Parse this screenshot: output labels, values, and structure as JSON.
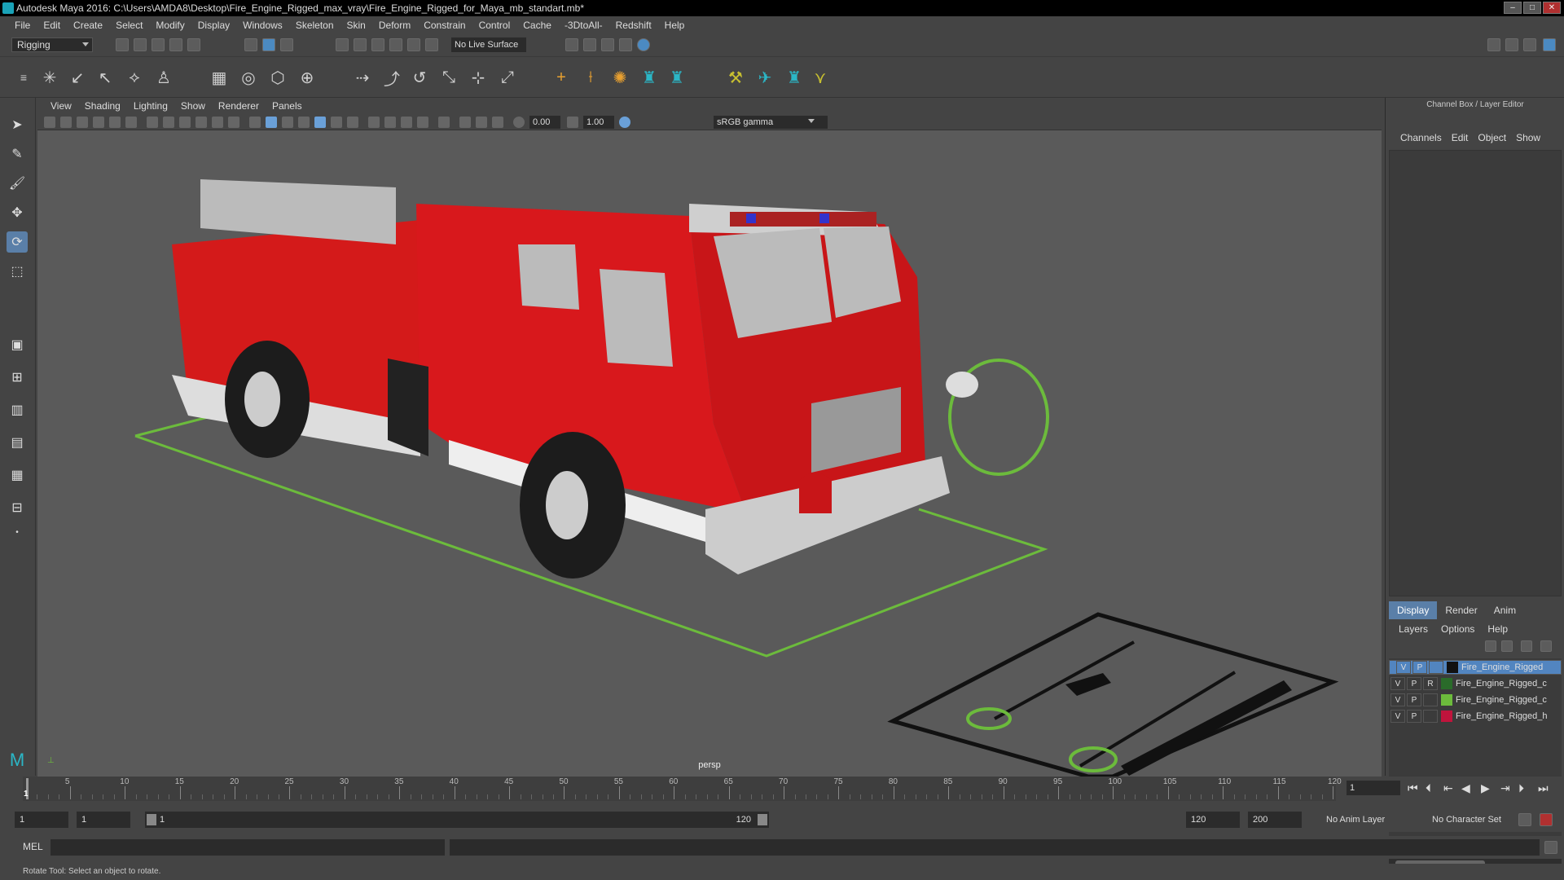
{
  "window": {
    "title": "Autodesk Maya 2016: C:\\Users\\AMDA8\\Desktop\\Fire_Engine_Rigged_max_vray\\Fire_Engine_Rigged_for_Maya_mb_standart.mb*"
  },
  "menubar": [
    "File",
    "Edit",
    "Create",
    "Select",
    "Modify",
    "Display",
    "Windows",
    "Skeleton",
    "Skin",
    "Deform",
    "Constrain",
    "Control",
    "Cache",
    "-3DtoAll-",
    "Redshift",
    "Help"
  ],
  "status_line": {
    "menuset": "Rigging",
    "live_surface": "No Live Surface"
  },
  "viewport": {
    "menu": [
      "View",
      "Shading",
      "Lighting",
      "Show",
      "Renderer",
      "Panels"
    ],
    "exposure": "0.00",
    "gamma": "1.00",
    "color_space": "sRGB gamma",
    "camera_label": "persp"
  },
  "channel_box": {
    "title": "Channel Box / Layer Editor",
    "menu": [
      "Channels",
      "Edit",
      "Object",
      "Show"
    ]
  },
  "layer_editor": {
    "tabs": [
      "Display",
      "Render",
      "Anim"
    ],
    "menu": [
      "Layers",
      "Options",
      "Help"
    ],
    "layers": [
      {
        "v": "V",
        "p": "P",
        "r": "",
        "color": "#111111",
        "name": "Fire_Engine_Rigged",
        "selected": true
      },
      {
        "v": "V",
        "p": "P",
        "r": "R",
        "color": "#2a6b2a",
        "name": "Fire_Engine_Rigged_c",
        "selected": false
      },
      {
        "v": "V",
        "p": "P",
        "r": "",
        "color": "#6cbb3c",
        "name": "Fire_Engine_Rigged_c",
        "selected": false
      },
      {
        "v": "V",
        "p": "P",
        "r": "",
        "color": "#c0143c",
        "name": "Fire_Engine_Rigged_h",
        "selected": false
      }
    ]
  },
  "timeline": {
    "ticks": [
      "1",
      "5",
      "10",
      "15",
      "20",
      "25",
      "30",
      "35",
      "40",
      "45",
      "50",
      "55",
      "60",
      "65",
      "70",
      "75",
      "80",
      "85",
      "90",
      "95",
      "100",
      "105",
      "110",
      "115",
      "120"
    ],
    "current_frame": "1",
    "current_frame_field": "1"
  },
  "range": {
    "start": "1",
    "playback_start": "1",
    "slider_start": "1",
    "slider_end": "120",
    "playback_end": "120",
    "end": "200",
    "anim_layer": "No Anim Layer",
    "character_set": "No Character Set"
  },
  "command_line": {
    "label": "MEL"
  },
  "help_line": "Rotate Tool: Select an object to rotate."
}
